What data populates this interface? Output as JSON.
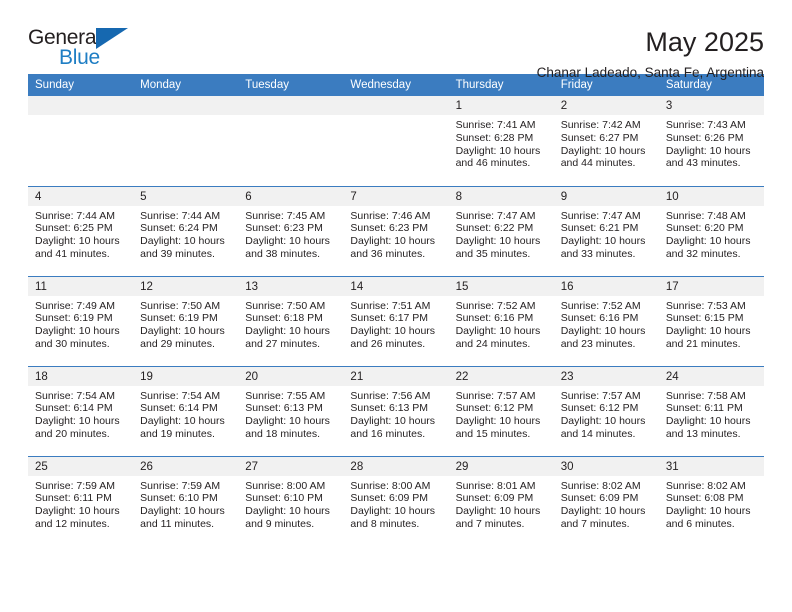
{
  "brand": {
    "name_part1": "General",
    "name_part2": "Blue",
    "triangle_icon": "brand-triangle-icon",
    "colors": {
      "dark": "#231f20",
      "blue": "#1f7ec4",
      "triangle": "#1668b0"
    }
  },
  "header": {
    "title": "May 2025",
    "subtitle": "Chanar Ladeado, Santa Fe, Argentina"
  },
  "theme": {
    "header_row_bg": "#3b7cc0",
    "header_row_text": "#ffffff",
    "daynum_bg": "#f1f1f1",
    "row_divider": "#3b7cc0",
    "page_bg": "#ffffff",
    "text": "#231f20"
  },
  "calendar": {
    "weekday_headers": [
      "Sunday",
      "Monday",
      "Tuesday",
      "Wednesday",
      "Thursday",
      "Friday",
      "Saturday"
    ],
    "weeks": [
      [
        {
          "day": "",
          "blank": true
        },
        {
          "day": "",
          "blank": true
        },
        {
          "day": "",
          "blank": true
        },
        {
          "day": "",
          "blank": true
        },
        {
          "day": "1",
          "sunrise": "Sunrise: 7:41 AM",
          "sunset": "Sunset: 6:28 PM",
          "daylight_l1": "Daylight: 10 hours",
          "daylight_l2": "and 46 minutes."
        },
        {
          "day": "2",
          "sunrise": "Sunrise: 7:42 AM",
          "sunset": "Sunset: 6:27 PM",
          "daylight_l1": "Daylight: 10 hours",
          "daylight_l2": "and 44 minutes."
        },
        {
          "day": "3",
          "sunrise": "Sunrise: 7:43 AM",
          "sunset": "Sunset: 6:26 PM",
          "daylight_l1": "Daylight: 10 hours",
          "daylight_l2": "and 43 minutes."
        }
      ],
      [
        {
          "day": "4",
          "sunrise": "Sunrise: 7:44 AM",
          "sunset": "Sunset: 6:25 PM",
          "daylight_l1": "Daylight: 10 hours",
          "daylight_l2": "and 41 minutes."
        },
        {
          "day": "5",
          "sunrise": "Sunrise: 7:44 AM",
          "sunset": "Sunset: 6:24 PM",
          "daylight_l1": "Daylight: 10 hours",
          "daylight_l2": "and 39 minutes."
        },
        {
          "day": "6",
          "sunrise": "Sunrise: 7:45 AM",
          "sunset": "Sunset: 6:23 PM",
          "daylight_l1": "Daylight: 10 hours",
          "daylight_l2": "and 38 minutes."
        },
        {
          "day": "7",
          "sunrise": "Sunrise: 7:46 AM",
          "sunset": "Sunset: 6:23 PM",
          "daylight_l1": "Daylight: 10 hours",
          "daylight_l2": "and 36 minutes."
        },
        {
          "day": "8",
          "sunrise": "Sunrise: 7:47 AM",
          "sunset": "Sunset: 6:22 PM",
          "daylight_l1": "Daylight: 10 hours",
          "daylight_l2": "and 35 minutes."
        },
        {
          "day": "9",
          "sunrise": "Sunrise: 7:47 AM",
          "sunset": "Sunset: 6:21 PM",
          "daylight_l1": "Daylight: 10 hours",
          "daylight_l2": "and 33 minutes."
        },
        {
          "day": "10",
          "sunrise": "Sunrise: 7:48 AM",
          "sunset": "Sunset: 6:20 PM",
          "daylight_l1": "Daylight: 10 hours",
          "daylight_l2": "and 32 minutes."
        }
      ],
      [
        {
          "day": "11",
          "sunrise": "Sunrise: 7:49 AM",
          "sunset": "Sunset: 6:19 PM",
          "daylight_l1": "Daylight: 10 hours",
          "daylight_l2": "and 30 minutes."
        },
        {
          "day": "12",
          "sunrise": "Sunrise: 7:50 AM",
          "sunset": "Sunset: 6:19 PM",
          "daylight_l1": "Daylight: 10 hours",
          "daylight_l2": "and 29 minutes."
        },
        {
          "day": "13",
          "sunrise": "Sunrise: 7:50 AM",
          "sunset": "Sunset: 6:18 PM",
          "daylight_l1": "Daylight: 10 hours",
          "daylight_l2": "and 27 minutes."
        },
        {
          "day": "14",
          "sunrise": "Sunrise: 7:51 AM",
          "sunset": "Sunset: 6:17 PM",
          "daylight_l1": "Daylight: 10 hours",
          "daylight_l2": "and 26 minutes."
        },
        {
          "day": "15",
          "sunrise": "Sunrise: 7:52 AM",
          "sunset": "Sunset: 6:16 PM",
          "daylight_l1": "Daylight: 10 hours",
          "daylight_l2": "and 24 minutes."
        },
        {
          "day": "16",
          "sunrise": "Sunrise: 7:52 AM",
          "sunset": "Sunset: 6:16 PM",
          "daylight_l1": "Daylight: 10 hours",
          "daylight_l2": "and 23 minutes."
        },
        {
          "day": "17",
          "sunrise": "Sunrise: 7:53 AM",
          "sunset": "Sunset: 6:15 PM",
          "daylight_l1": "Daylight: 10 hours",
          "daylight_l2": "and 21 minutes."
        }
      ],
      [
        {
          "day": "18",
          "sunrise": "Sunrise: 7:54 AM",
          "sunset": "Sunset: 6:14 PM",
          "daylight_l1": "Daylight: 10 hours",
          "daylight_l2": "and 20 minutes."
        },
        {
          "day": "19",
          "sunrise": "Sunrise: 7:54 AM",
          "sunset": "Sunset: 6:14 PM",
          "daylight_l1": "Daylight: 10 hours",
          "daylight_l2": "and 19 minutes."
        },
        {
          "day": "20",
          "sunrise": "Sunrise: 7:55 AM",
          "sunset": "Sunset: 6:13 PM",
          "daylight_l1": "Daylight: 10 hours",
          "daylight_l2": "and 18 minutes."
        },
        {
          "day": "21",
          "sunrise": "Sunrise: 7:56 AM",
          "sunset": "Sunset: 6:13 PM",
          "daylight_l1": "Daylight: 10 hours",
          "daylight_l2": "and 16 minutes."
        },
        {
          "day": "22",
          "sunrise": "Sunrise: 7:57 AM",
          "sunset": "Sunset: 6:12 PM",
          "daylight_l1": "Daylight: 10 hours",
          "daylight_l2": "and 15 minutes."
        },
        {
          "day": "23",
          "sunrise": "Sunrise: 7:57 AM",
          "sunset": "Sunset: 6:12 PM",
          "daylight_l1": "Daylight: 10 hours",
          "daylight_l2": "and 14 minutes."
        },
        {
          "day": "24",
          "sunrise": "Sunrise: 7:58 AM",
          "sunset": "Sunset: 6:11 PM",
          "daylight_l1": "Daylight: 10 hours",
          "daylight_l2": "and 13 minutes."
        }
      ],
      [
        {
          "day": "25",
          "sunrise": "Sunrise: 7:59 AM",
          "sunset": "Sunset: 6:11 PM",
          "daylight_l1": "Daylight: 10 hours",
          "daylight_l2": "and 12 minutes."
        },
        {
          "day": "26",
          "sunrise": "Sunrise: 7:59 AM",
          "sunset": "Sunset: 6:10 PM",
          "daylight_l1": "Daylight: 10 hours",
          "daylight_l2": "and 11 minutes."
        },
        {
          "day": "27",
          "sunrise": "Sunrise: 8:00 AM",
          "sunset": "Sunset: 6:10 PM",
          "daylight_l1": "Daylight: 10 hours",
          "daylight_l2": "and 9 minutes."
        },
        {
          "day": "28",
          "sunrise": "Sunrise: 8:00 AM",
          "sunset": "Sunset: 6:09 PM",
          "daylight_l1": "Daylight: 10 hours",
          "daylight_l2": "and 8 minutes."
        },
        {
          "day": "29",
          "sunrise": "Sunrise: 8:01 AM",
          "sunset": "Sunset: 6:09 PM",
          "daylight_l1": "Daylight: 10 hours",
          "daylight_l2": "and 7 minutes."
        },
        {
          "day": "30",
          "sunrise": "Sunrise: 8:02 AM",
          "sunset": "Sunset: 6:09 PM",
          "daylight_l1": "Daylight: 10 hours",
          "daylight_l2": "and 7 minutes."
        },
        {
          "day": "31",
          "sunrise": "Sunrise: 8:02 AM",
          "sunset": "Sunset: 6:08 PM",
          "daylight_l1": "Daylight: 10 hours",
          "daylight_l2": "and 6 minutes."
        }
      ]
    ]
  }
}
